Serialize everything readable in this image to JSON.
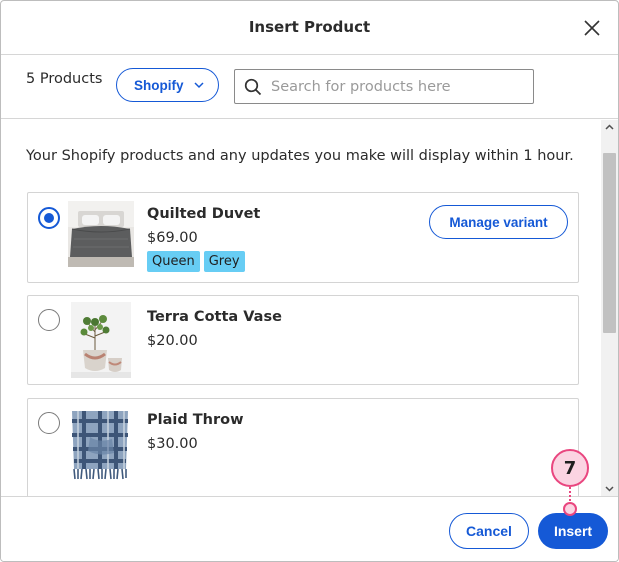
{
  "dialog": {
    "title": "Insert Product",
    "close_icon": "close-icon"
  },
  "toolbar": {
    "count": "5 Products",
    "source_label": "Shopify",
    "search_placeholder": "Search for products here",
    "search_value": ""
  },
  "content": {
    "notice": "Your Shopify products and any updates you make will display within 1 hour.",
    "products": [
      {
        "name": "Quilted Duvet",
        "price": "$69.00",
        "selected": true,
        "tags": [
          "Queen",
          "Grey"
        ],
        "action": "Manage variant",
        "image": "duvet-bed-image"
      },
      {
        "name": "Terra Cotta Vase",
        "price": "$20.00",
        "selected": false,
        "image": "vase-plant-image"
      },
      {
        "name": "Plaid Throw",
        "price": "$30.00",
        "selected": false,
        "image": "plaid-throw-image"
      }
    ]
  },
  "footer": {
    "cancel_label": "Cancel",
    "insert_label": "Insert"
  },
  "callout": {
    "step": "7"
  },
  "colors": {
    "accent": "#1559d6",
    "tag": "#67cdf4",
    "callout": "#e9467f"
  }
}
